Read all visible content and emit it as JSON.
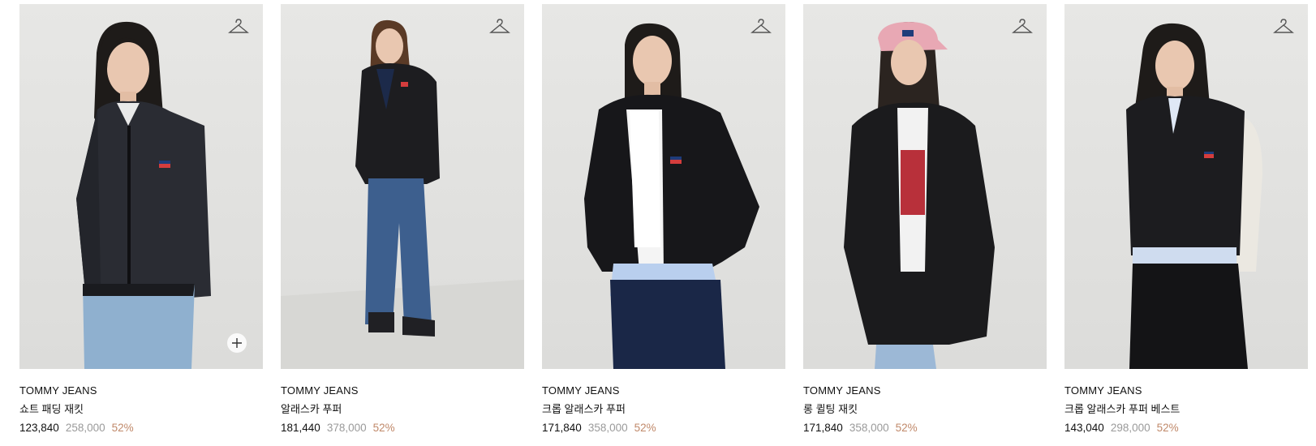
{
  "products": [
    {
      "brand": "TOMMY JEANS",
      "name": "쇼트 패딩 재킷",
      "sale_price": "123,840",
      "original_price": "258,000",
      "discount": "52%",
      "image": "model-black-quilted-short-jacket",
      "has_add_button": true
    },
    {
      "brand": "TOMMY JEANS",
      "name": "알래스카 푸퍼",
      "sale_price": "181,440",
      "original_price": "378,000",
      "discount": "52%",
      "image": "model-black-alaska-puffer-full-body",
      "has_add_button": false
    },
    {
      "brand": "TOMMY JEANS",
      "name": "크롭 알래스카 푸퍼",
      "sale_price": "171,840",
      "original_price": "358,000",
      "discount": "52%",
      "image": "model-black-cropped-puffer",
      "has_add_button": false
    },
    {
      "brand": "TOMMY JEANS",
      "name": "롱 퀼팅 재킷",
      "sale_price": "171,840",
      "original_price": "358,000",
      "discount": "52%",
      "image": "model-pink-cap-long-quilted-jacket",
      "has_add_button": false
    },
    {
      "brand": "TOMMY JEANS",
      "name": "크롭 알래스카 푸퍼 베스트",
      "sale_price": "143,040",
      "original_price": "298,000",
      "discount": "52%",
      "image": "model-black-puffer-vest",
      "has_add_button": false
    }
  ],
  "icons": {
    "wishlist": "hanger-icon",
    "add": "plus-icon"
  },
  "colors": {
    "discount": "#c0896a",
    "original_price": "#9a9a9a",
    "image_background": "#e3e3e1"
  }
}
